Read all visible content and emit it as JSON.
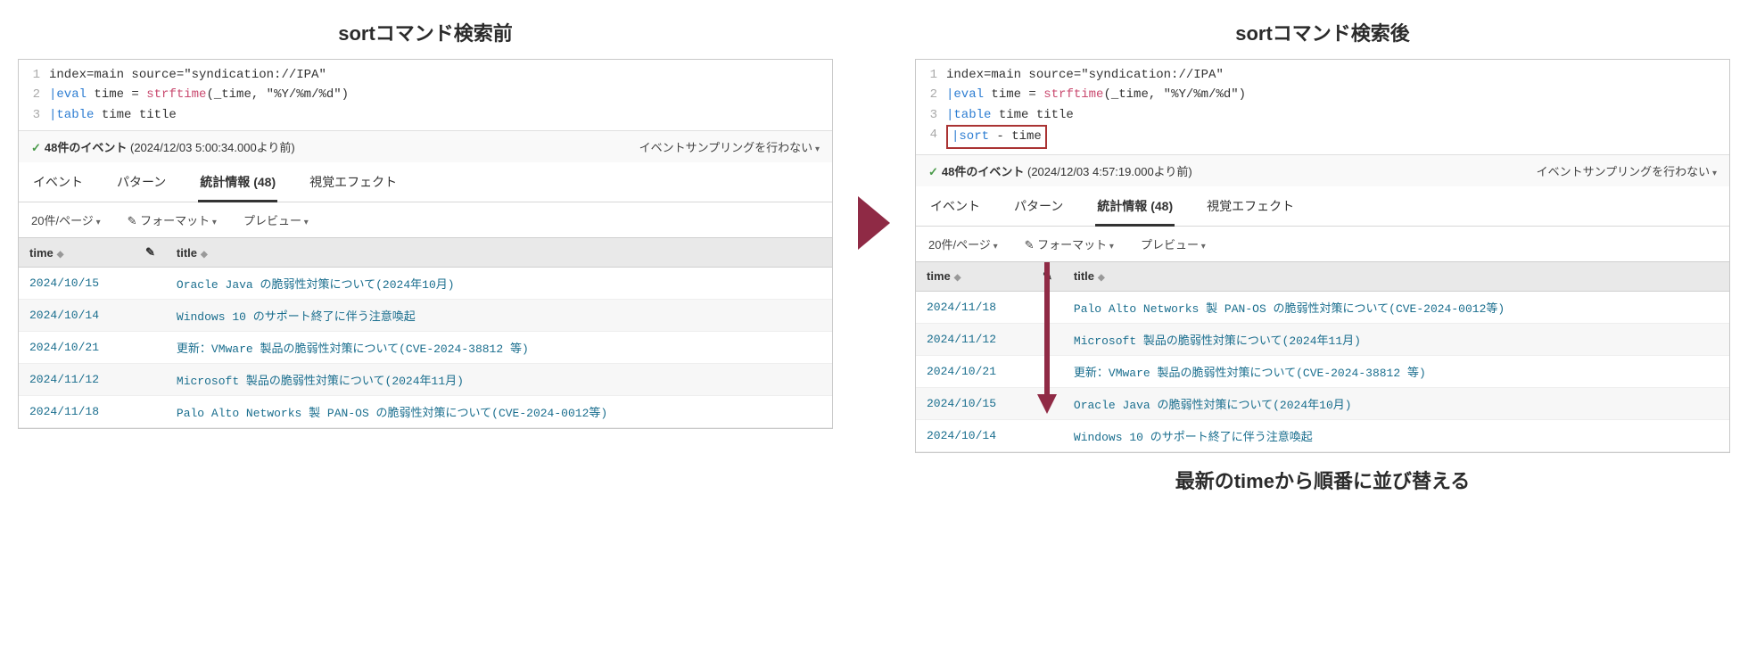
{
  "left": {
    "title": "sortコマンド検索前",
    "code_lines": [
      {
        "n": "1",
        "parts": [
          {
            "t": "index=main source=\"syndication://IPA\"",
            "c": ""
          }
        ]
      },
      {
        "n": "2",
        "parts": [
          {
            "t": "|",
            "c": "pipe"
          },
          {
            "t": "eval",
            "c": "cmd"
          },
          {
            "t": " time = ",
            "c": ""
          },
          {
            "t": "strftime",
            "c": "fn"
          },
          {
            "t": "(_time, \"%Y/%m/%d\")",
            "c": ""
          }
        ]
      },
      {
        "n": "3",
        "parts": [
          {
            "t": "|",
            "c": "pipe"
          },
          {
            "t": "table",
            "c": "cmd"
          },
          {
            "t": " time title",
            "c": ""
          }
        ]
      }
    ],
    "status_count": "48件のイベント",
    "status_time": "(2024/12/03 5:00:34.000より前)",
    "sampling": "イベントサンプリングを行わない",
    "tabs": {
      "events": "イベント",
      "patterns": "パターン",
      "stats": "統計情報",
      "stats_count": "(48)",
      "viz": "視覚エフェクト"
    },
    "controls": {
      "perpage": "20件/ページ",
      "format": "フォーマット",
      "preview": "プレビュー"
    },
    "headers": {
      "time": "time",
      "title": "title"
    },
    "rows": [
      {
        "time": "2024/10/15",
        "title": "Oracle Java の脆弱性対策について(2024年10月)"
      },
      {
        "time": "2024/10/14",
        "title": "Windows 10 のサポート終了に伴う注意喚起"
      },
      {
        "time": "2024/10/21",
        "title": "更新：VMware 製品の脆弱性対策について(CVE-2024-38812 等)"
      },
      {
        "time": "2024/11/12",
        "title": "Microsoft 製品の脆弱性対策について(2024年11月)"
      },
      {
        "time": "2024/11/18",
        "title": "Palo Alto Networks 製 PAN-OS の脆弱性対策について(CVE-2024-0012等)"
      }
    ]
  },
  "right": {
    "title": "sortコマンド検索後",
    "code_lines": [
      {
        "n": "1",
        "parts": [
          {
            "t": "index=main source=\"syndication://IPA\"",
            "c": ""
          }
        ]
      },
      {
        "n": "2",
        "parts": [
          {
            "t": "|",
            "c": "pipe"
          },
          {
            "t": "eval",
            "c": "cmd"
          },
          {
            "t": " time = ",
            "c": ""
          },
          {
            "t": "strftime",
            "c": "fn"
          },
          {
            "t": "(_time, \"%Y/%m/%d\")",
            "c": ""
          }
        ]
      },
      {
        "n": "3",
        "parts": [
          {
            "t": "|",
            "c": "pipe"
          },
          {
            "t": "table",
            "c": "cmd"
          },
          {
            "t": " time title",
            "c": ""
          }
        ]
      },
      {
        "n": "4",
        "hl": true,
        "parts": [
          {
            "t": "|",
            "c": "pipe"
          },
          {
            "t": "sort",
            "c": "cmd"
          },
          {
            "t": " - time",
            "c": ""
          }
        ]
      }
    ],
    "status_count": "48件のイベント",
    "status_time": "(2024/12/03 4:57:19.000より前)",
    "sampling": "イベントサンプリングを行わない",
    "tabs": {
      "events": "イベント",
      "patterns": "パターン",
      "stats": "統計情報",
      "stats_count": "(48)",
      "viz": "視覚エフェクト"
    },
    "controls": {
      "perpage": "20件/ページ",
      "format": "フォーマット",
      "preview": "プレビュー"
    },
    "headers": {
      "time": "time",
      "title": "title"
    },
    "rows": [
      {
        "time": "2024/11/18",
        "title": "Palo Alto Networks 製 PAN-OS の脆弱性対策について(CVE-2024-0012等)"
      },
      {
        "time": "2024/11/12",
        "title": "Microsoft 製品の脆弱性対策について(2024年11月)"
      },
      {
        "time": "2024/10/21",
        "title": "更新：VMware 製品の脆弱性対策について(CVE-2024-38812 等)"
      },
      {
        "time": "2024/10/15",
        "title": "Oracle Java の脆弱性対策について(2024年10月)"
      },
      {
        "time": "2024/10/14",
        "title": "Windows 10 のサポート終了に伴う注意喚起"
      }
    ],
    "bottom_note": "最新のtimeから順番に並び替える"
  },
  "colors": {
    "arrow": "#8f2a45"
  }
}
